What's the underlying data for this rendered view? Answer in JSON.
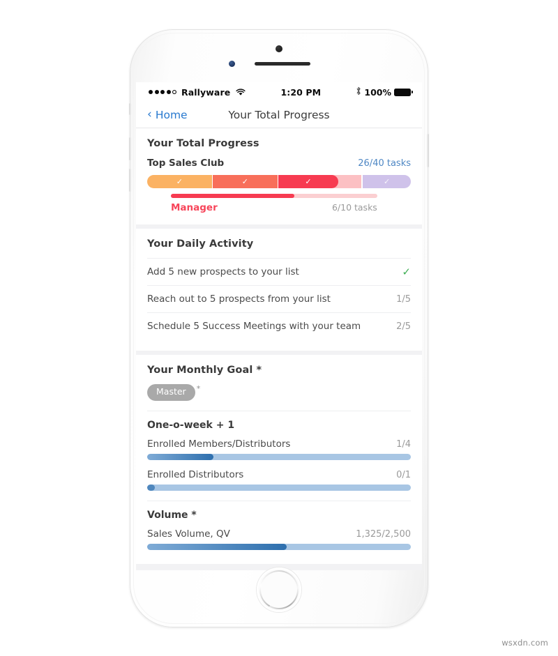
{
  "device": {
    "icons": {
      "sensor": "proximity-sensor",
      "earpiece": "earpiece-speaker",
      "camera": "front-camera",
      "home": "home-button"
    }
  },
  "status_bar": {
    "signal_dots_filled": 4,
    "signal_dots_total": 5,
    "carrier": "Rallyware",
    "wifi_icon": "wifi-icon",
    "time": "1:20 PM",
    "bluetooth_icon": "bluetooth-icon",
    "battery_percent": "100%",
    "battery_icon": "battery-full-icon"
  },
  "nav_bar": {
    "back_icon": "chevron-left-icon",
    "back_label": "Home",
    "title": "Your Total Progress"
  },
  "total_progress": {
    "title": "Your Total Progress",
    "club_name": "Top Sales Club",
    "club_tasks": "26/40 tasks",
    "segments": [
      {
        "name": "segment-orange",
        "color": "#fbb263",
        "left_pct": 0,
        "width_pct": 24.5,
        "check": "✓",
        "check_opacity": 0.95
      },
      {
        "name": "segment-coral",
        "color": "#f86f5a",
        "left_pct": 24.9,
        "width_pct": 24.5,
        "check": "✓",
        "check_opacity": 0.95
      },
      {
        "name": "segment-red",
        "color": "#f73b51",
        "left_pct": 49.8,
        "width_pct": 22.5,
        "check": "✓",
        "check_opacity": 1
      },
      {
        "name": "segment-pink",
        "color": "#fcc0c3",
        "left_pct": 72.6,
        "width_pct": 8.7,
        "check": "",
        "check_opacity": 0
      },
      {
        "name": "segment-purple",
        "color": "#cfc2ea",
        "left_pct": 81.8,
        "width_pct": 18.2,
        "check": "✓",
        "check_opacity": 0.85
      }
    ],
    "manager_label": "Manager",
    "manager_tasks": "6/10 tasks",
    "manager_fill_pct": 60,
    "colors": {
      "tasks_link": "#4e87c4",
      "manager": "#f7455a",
      "manager_track": "#fbcfd1"
    }
  },
  "daily_activity": {
    "title": "Your Daily Activity",
    "rows": [
      {
        "label": "Add 5 new prospects to your list",
        "value": "",
        "done": true,
        "check": "✓"
      },
      {
        "label": "Reach out to 5 prospects from your list",
        "value": "1/5",
        "done": false,
        "check": ""
      },
      {
        "label": "Schedule 5 Success Meetings with your team",
        "value": "2/5",
        "done": false,
        "check": ""
      }
    ],
    "check_color": "#3fae55"
  },
  "monthly_goal": {
    "title": "Your Monthly Goal *",
    "badge_label": "Master",
    "badge_star": "*",
    "badge_color": "#a9a9a9",
    "sections": [
      {
        "name": "one-o-week",
        "title": "One-o-week + 1",
        "metrics": [
          {
            "label": "Enrolled Members/Distributors",
            "value": "1/4",
            "fill_pct": 25
          },
          {
            "label": "Enrolled Distributors",
            "value": "0/1",
            "fill_pct": 2
          }
        ]
      },
      {
        "name": "volume",
        "title": "Volume *",
        "metrics": [
          {
            "label": "Sales Volume, QV",
            "value": "1,325/2,500",
            "fill_pct": 53
          }
        ]
      }
    ],
    "bar_colors": {
      "track": "#a8c6e4",
      "fill_start": "#7fabd6",
      "fill_end": "#2d6fae"
    }
  },
  "watermark": "wsxdn.com"
}
